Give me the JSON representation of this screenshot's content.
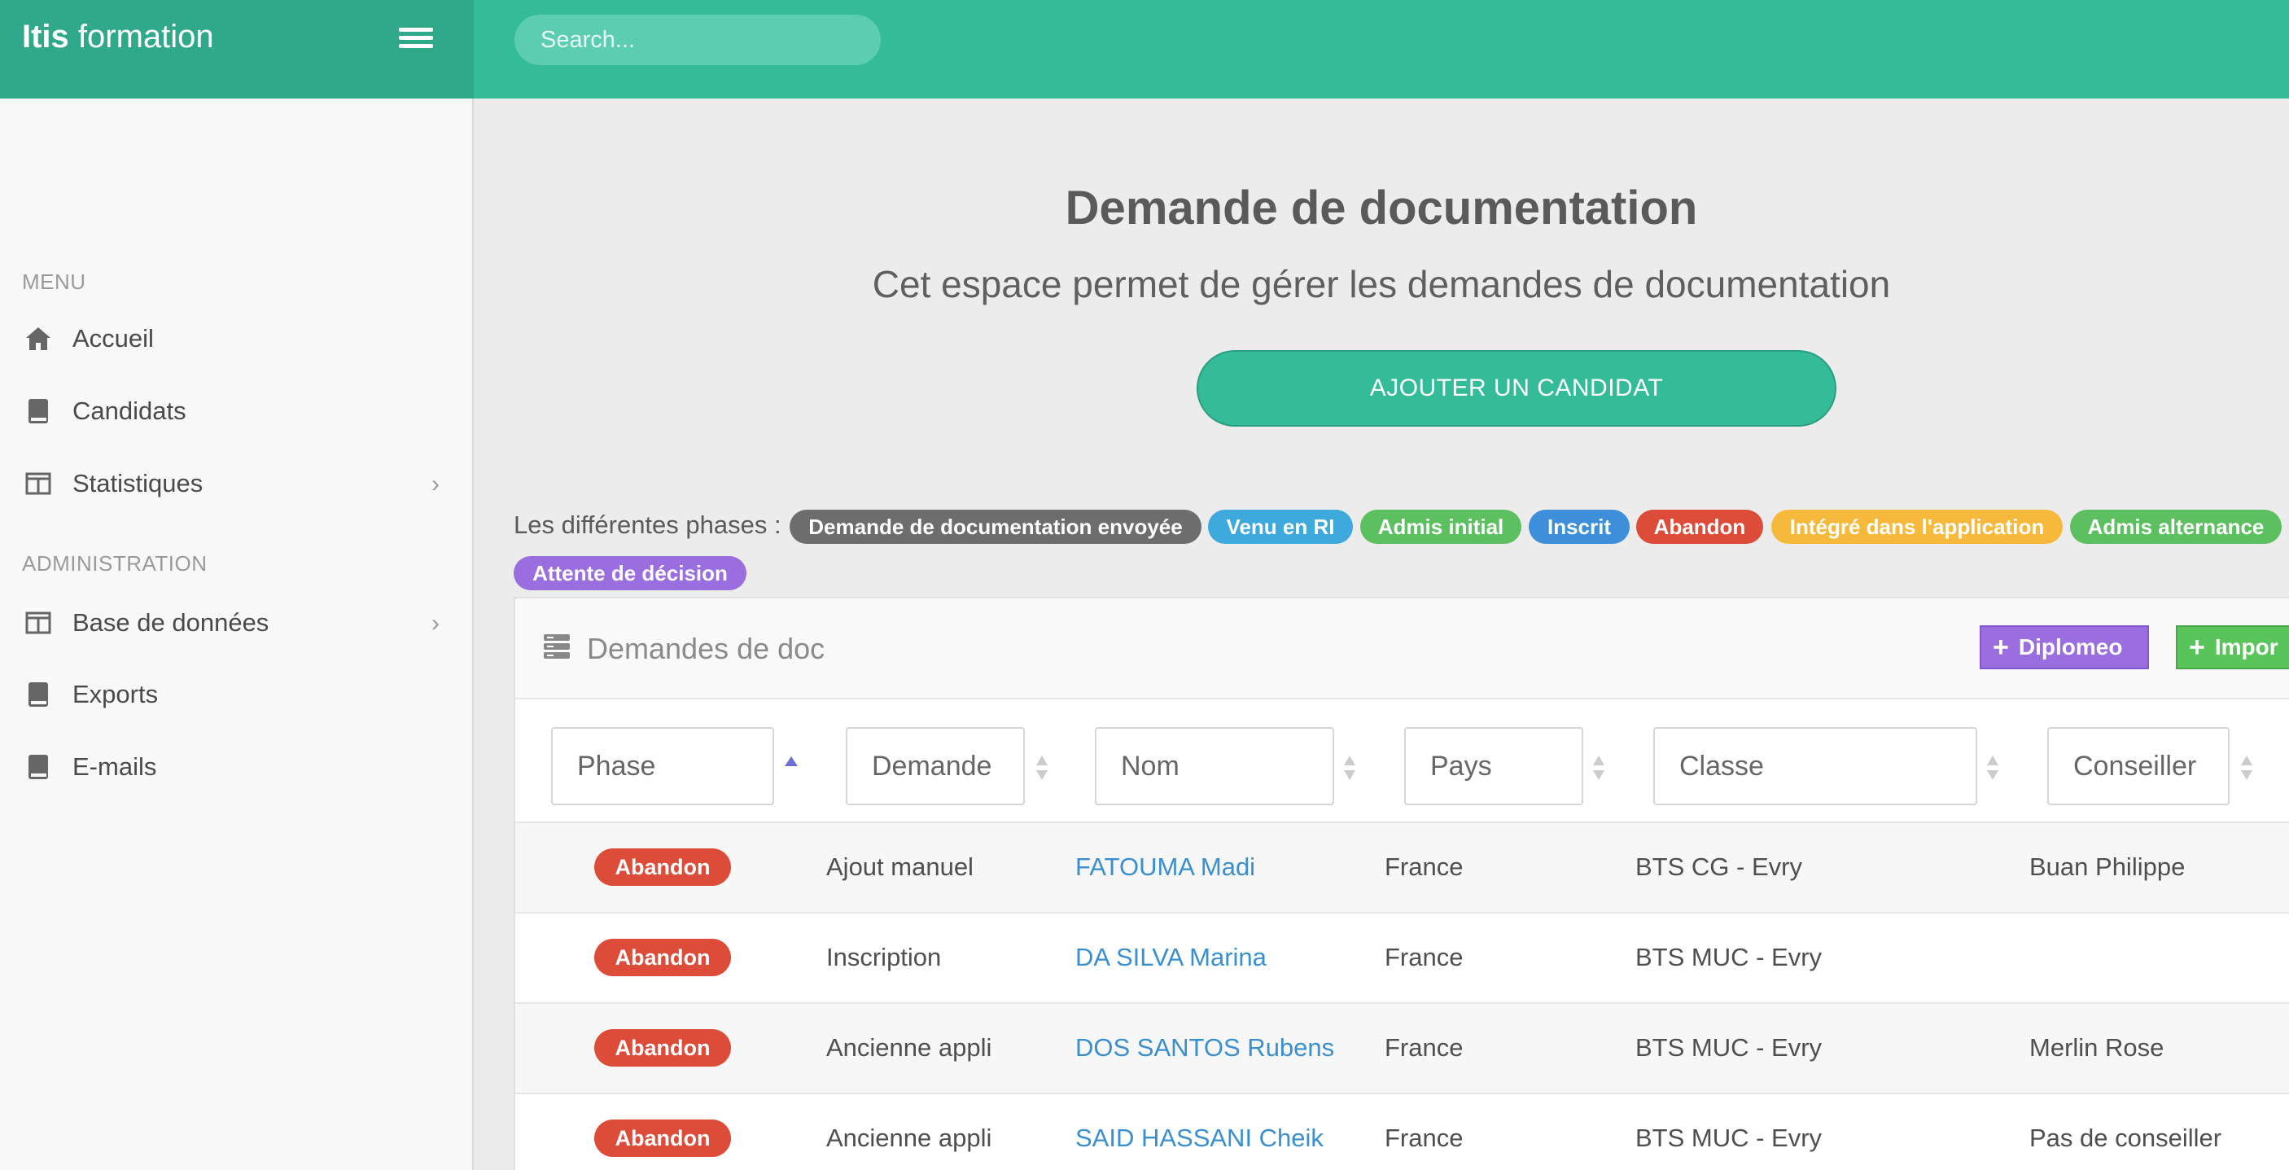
{
  "brand": {
    "bold": "Itis",
    "rest": " formation"
  },
  "search": {
    "placeholder": "Search..."
  },
  "sidebar": {
    "menu_title": "MENU",
    "admin_title": "ADMINISTRATION",
    "items": [
      {
        "label": "Accueil",
        "icon": "home-icon"
      },
      {
        "label": "Candidats",
        "icon": "book-icon"
      },
      {
        "label": "Statistiques",
        "icon": "columns-icon",
        "chevron": "›"
      },
      {
        "label": "Base de données",
        "icon": "columns-icon",
        "chevron": "›"
      },
      {
        "label": "Exports",
        "icon": "book-icon"
      },
      {
        "label": "E-mails",
        "icon": "book-icon"
      }
    ]
  },
  "main": {
    "title": "Demande de documentation",
    "subtitle": "Cet espace permet de gérer les demandes de documentation",
    "add_button": "AJOUTER UN CANDIDAT",
    "phases_label": "Les différentes phases :",
    "phases": [
      {
        "label": "Demande de documentation envoyée",
        "color": "#6d6d6d"
      },
      {
        "label": "Venu en RI",
        "color": "#3ea9dc"
      },
      {
        "label": "Admis initial",
        "color": "#5cc060"
      },
      {
        "label": "Inscrit",
        "color": "#3c8fd8"
      },
      {
        "label": "Abandon",
        "color": "#dd4b39"
      },
      {
        "label": "Intégré dans l'application",
        "color": "#f6b93b"
      },
      {
        "label": "Admis alternance",
        "color": "#5cc060"
      },
      {
        "label": "Attente de décision",
        "color": "#9b6ee0"
      }
    ]
  },
  "card": {
    "title": "Demandes de doc",
    "diplomeo_label": "Diplomeo",
    "import_label": "Impor",
    "filters": {
      "phase": "Phase",
      "demande": "Demande",
      "nom": "Nom",
      "pays": "Pays",
      "classe": "Classe",
      "conseiller": "Conseiller"
    },
    "rows": [
      {
        "phase": "Abandon",
        "demande": "Ajout manuel",
        "nom": "FATOUMA Madi",
        "pays": "France",
        "classe": "BTS CG - Evry",
        "conseiller": "Buan Philippe"
      },
      {
        "phase": "Abandon",
        "demande": "Inscription",
        "nom": "DA SILVA Marina",
        "pays": "France",
        "classe": "BTS MUC - Evry",
        "conseiller": ""
      },
      {
        "phase": "Abandon",
        "demande": "Ancienne appli",
        "nom": "DOS SANTOS Rubens",
        "pays": "France",
        "classe": "BTS MUC - Evry",
        "conseiller": "Merlin Rose"
      },
      {
        "phase": "Abandon",
        "demande": "Ancienne appli",
        "nom": "SAID HASSANI Cheik",
        "pays": "France",
        "classe": "BTS MUC - Evry",
        "conseiller": "Pas de conseiller"
      }
    ]
  }
}
